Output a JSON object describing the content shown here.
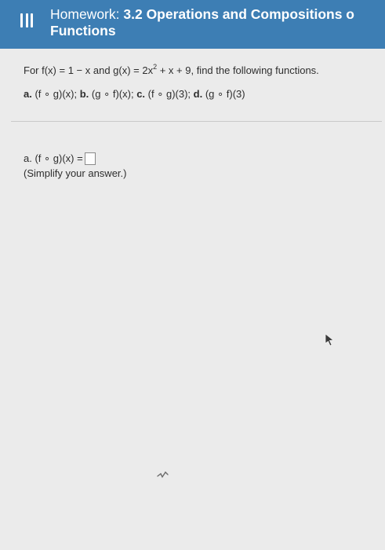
{
  "header": {
    "title_prefix": "Homework:",
    "title_bold": "3.2 Operations and Compositions o",
    "subtitle": "Functions"
  },
  "problem": {
    "intro_before_exp": "For f(x) = 1 − x and g(x) = 2x",
    "exponent": "2",
    "intro_after_exp": " + x + 9, find the following functions.",
    "parts": [
      {
        "label": "a.",
        "text": "(f ∘ g)(x);"
      },
      {
        "label": "b.",
        "text": "(g ∘ f)(x);"
      },
      {
        "label": "c.",
        "text": "(f ∘ g)(3);"
      },
      {
        "label": "d.",
        "text": "(g ∘ f)(3)"
      }
    ]
  },
  "answer": {
    "label": "a.",
    "expression": "(f ∘ g)(x) =",
    "value": "",
    "hint": "(Simplify your answer.)"
  },
  "icons": {
    "menu": "hamburger-menu-icon",
    "cursor": "mouse-pointer-icon"
  },
  "colors": {
    "header_bg": "#3d7eb4",
    "page_bg": "#ebebeb"
  }
}
